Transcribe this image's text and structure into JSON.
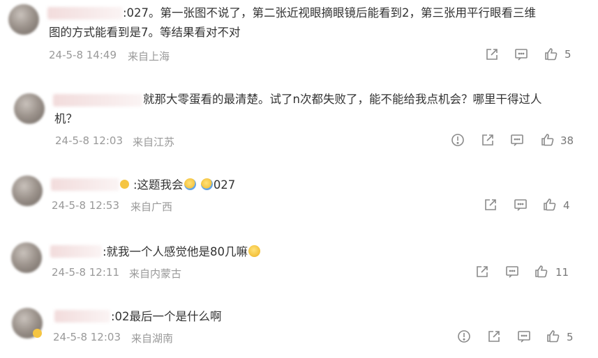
{
  "comments": [
    {
      "text_line1": ":027。第一张图不说了，第二张近视眼摘眼镜后能看到2，第三张用平行眼看三维",
      "text_line2": "图的方式能看到是7。等结果看对不对",
      "date": "24-5-8 14:49",
      "location": "来自上海",
      "likes": "5"
    },
    {
      "text_line1": "就那大零蛋看的最清楚。试了n次都失败了，能不能给我点机会？哪里干得过人",
      "text_line2": "机？",
      "date": "24-5-8 12:03",
      "location": "来自江苏",
      "likes": "38"
    },
    {
      "text_before": ":这题我会",
      "text_after": "027",
      "date": "24-5-8 12:53",
      "location": "来自广西",
      "likes": "4"
    },
    {
      "text": ":就我一个人感觉他是80几嘛",
      "date": "24-5-8 12:11",
      "location": "来自内蒙古",
      "likes": "11"
    },
    {
      "text": ":02最后一个是什么啊",
      "date": "24-5-8 12:03",
      "location": "来自湖南",
      "likes": "5"
    }
  ],
  "icons": {
    "share": "share-icon",
    "comment": "comment-icon",
    "like": "thumbs-up-icon",
    "report": "report-icon"
  },
  "colors": {
    "text": "#333333",
    "meta": "#999999",
    "icon": "#888888"
  }
}
